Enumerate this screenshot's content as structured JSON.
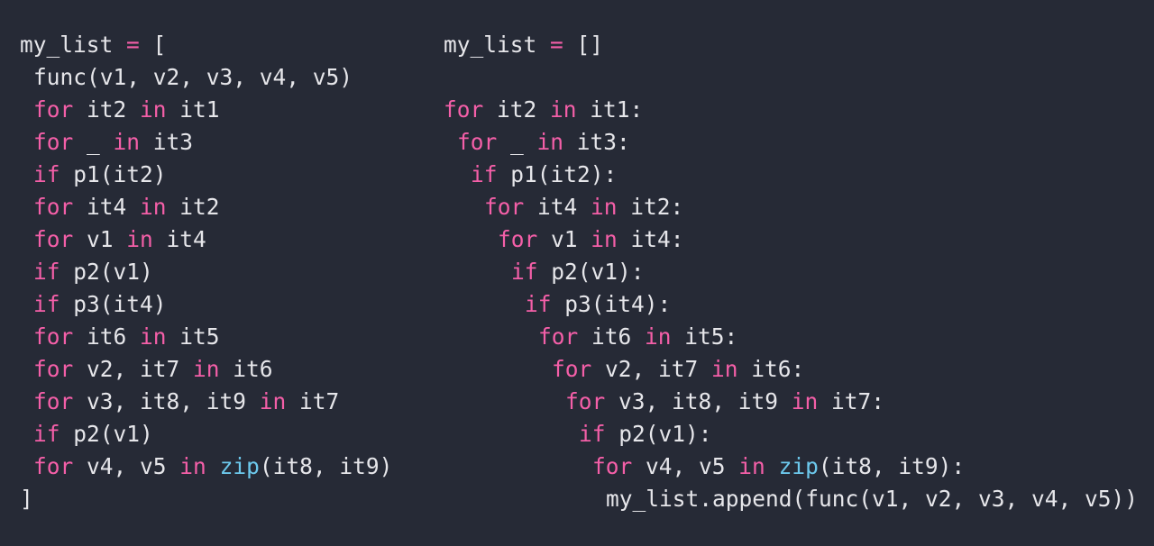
{
  "colors": {
    "background": "#262a36",
    "text": "#e6e6ea",
    "keyword": "#f45fa8",
    "builtin": "#6cc8ec"
  },
  "left_code": {
    "lines": [
      {
        "indent": 0,
        "tokens": [
          {
            "t": "my_list ",
            "k": "tx"
          },
          {
            "t": "=",
            "k": "kw"
          },
          {
            "t": " [",
            "k": "tx"
          }
        ]
      },
      {
        "indent": 1,
        "tokens": [
          {
            "t": "func(v1, v2, v3, v4, v5)",
            "k": "tx"
          }
        ]
      },
      {
        "indent": 1,
        "tokens": [
          {
            "t": "for",
            "k": "kw"
          },
          {
            "t": " it2 ",
            "k": "tx"
          },
          {
            "t": "in",
            "k": "kw"
          },
          {
            "t": " it1",
            "k": "tx"
          }
        ]
      },
      {
        "indent": 1,
        "tokens": [
          {
            "t": "for",
            "k": "kw"
          },
          {
            "t": " _ ",
            "k": "tx"
          },
          {
            "t": "in",
            "k": "kw"
          },
          {
            "t": " it3",
            "k": "tx"
          }
        ]
      },
      {
        "indent": 1,
        "tokens": [
          {
            "t": "if",
            "k": "kw"
          },
          {
            "t": " p1(it2)",
            "k": "tx"
          }
        ]
      },
      {
        "indent": 1,
        "tokens": [
          {
            "t": "for",
            "k": "kw"
          },
          {
            "t": " it4 ",
            "k": "tx"
          },
          {
            "t": "in",
            "k": "kw"
          },
          {
            "t": " it2",
            "k": "tx"
          }
        ]
      },
      {
        "indent": 1,
        "tokens": [
          {
            "t": "for",
            "k": "kw"
          },
          {
            "t": " v1 ",
            "k": "tx"
          },
          {
            "t": "in",
            "k": "kw"
          },
          {
            "t": " it4",
            "k": "tx"
          }
        ]
      },
      {
        "indent": 1,
        "tokens": [
          {
            "t": "if",
            "k": "kw"
          },
          {
            "t": " p2(v1)",
            "k": "tx"
          }
        ]
      },
      {
        "indent": 1,
        "tokens": [
          {
            "t": "if",
            "k": "kw"
          },
          {
            "t": " p3(it4)",
            "k": "tx"
          }
        ]
      },
      {
        "indent": 1,
        "tokens": [
          {
            "t": "for",
            "k": "kw"
          },
          {
            "t": " it6 ",
            "k": "tx"
          },
          {
            "t": "in",
            "k": "kw"
          },
          {
            "t": " it5",
            "k": "tx"
          }
        ]
      },
      {
        "indent": 1,
        "tokens": [
          {
            "t": "for",
            "k": "kw"
          },
          {
            "t": " v2, it7 ",
            "k": "tx"
          },
          {
            "t": "in",
            "k": "kw"
          },
          {
            "t": " it6",
            "k": "tx"
          }
        ]
      },
      {
        "indent": 1,
        "tokens": [
          {
            "t": "for",
            "k": "kw"
          },
          {
            "t": " v3, it8, it9 ",
            "k": "tx"
          },
          {
            "t": "in",
            "k": "kw"
          },
          {
            "t": " it7",
            "k": "tx"
          }
        ]
      },
      {
        "indent": 1,
        "tokens": [
          {
            "t": "if",
            "k": "kw"
          },
          {
            "t": " p2(v1)",
            "k": "tx"
          }
        ]
      },
      {
        "indent": 1,
        "tokens": [
          {
            "t": "for",
            "k": "kw"
          },
          {
            "t": " v4, v5 ",
            "k": "tx"
          },
          {
            "t": "in",
            "k": "kw"
          },
          {
            "t": " ",
            "k": "tx"
          },
          {
            "t": "zip",
            "k": "bi"
          },
          {
            "t": "(it8, it9)",
            "k": "tx"
          }
        ]
      },
      {
        "indent": 0,
        "tokens": [
          {
            "t": "]",
            "k": "tx"
          }
        ]
      }
    ]
  },
  "right_code": {
    "lines": [
      {
        "indent": 0,
        "tokens": [
          {
            "t": "my_list ",
            "k": "tx"
          },
          {
            "t": "=",
            "k": "kw"
          },
          {
            "t": " []",
            "k": "tx"
          }
        ]
      },
      {
        "indent": 0,
        "tokens": []
      },
      {
        "indent": 0,
        "tokens": [
          {
            "t": "for",
            "k": "kw"
          },
          {
            "t": " it2 ",
            "k": "tx"
          },
          {
            "t": "in",
            "k": "kw"
          },
          {
            "t": " it1:",
            "k": "tx"
          }
        ]
      },
      {
        "indent": 1,
        "tokens": [
          {
            "t": "for",
            "k": "kw"
          },
          {
            "t": " _ ",
            "k": "tx"
          },
          {
            "t": "in",
            "k": "kw"
          },
          {
            "t": " it3:",
            "k": "tx"
          }
        ]
      },
      {
        "indent": 2,
        "tokens": [
          {
            "t": "if",
            "k": "kw"
          },
          {
            "t": " p1(it2):",
            "k": "tx"
          }
        ]
      },
      {
        "indent": 3,
        "tokens": [
          {
            "t": "for",
            "k": "kw"
          },
          {
            "t": " it4 ",
            "k": "tx"
          },
          {
            "t": "in",
            "k": "kw"
          },
          {
            "t": " it2:",
            "k": "tx"
          }
        ]
      },
      {
        "indent": 4,
        "tokens": [
          {
            "t": "for",
            "k": "kw"
          },
          {
            "t": " v1 ",
            "k": "tx"
          },
          {
            "t": "in",
            "k": "kw"
          },
          {
            "t": " it4:",
            "k": "tx"
          }
        ]
      },
      {
        "indent": 5,
        "tokens": [
          {
            "t": "if",
            "k": "kw"
          },
          {
            "t": " p2(v1):",
            "k": "tx"
          }
        ]
      },
      {
        "indent": 6,
        "tokens": [
          {
            "t": "if",
            "k": "kw"
          },
          {
            "t": " p3(it4):",
            "k": "tx"
          }
        ]
      },
      {
        "indent": 7,
        "tokens": [
          {
            "t": "for",
            "k": "kw"
          },
          {
            "t": " it6 ",
            "k": "tx"
          },
          {
            "t": "in",
            "k": "kw"
          },
          {
            "t": " it5:",
            "k": "tx"
          }
        ]
      },
      {
        "indent": 8,
        "tokens": [
          {
            "t": "for",
            "k": "kw"
          },
          {
            "t": " v2, it7 ",
            "k": "tx"
          },
          {
            "t": "in",
            "k": "kw"
          },
          {
            "t": " it6:",
            "k": "tx"
          }
        ]
      },
      {
        "indent": 9,
        "tokens": [
          {
            "t": "for",
            "k": "kw"
          },
          {
            "t": " v3, it8, it9 ",
            "k": "tx"
          },
          {
            "t": "in",
            "k": "kw"
          },
          {
            "t": " it7:",
            "k": "tx"
          }
        ]
      },
      {
        "indent": 10,
        "tokens": [
          {
            "t": "if",
            "k": "kw"
          },
          {
            "t": " p2(v1):",
            "k": "tx"
          }
        ]
      },
      {
        "indent": 11,
        "tokens": [
          {
            "t": "for",
            "k": "kw"
          },
          {
            "t": " v4, v5 ",
            "k": "tx"
          },
          {
            "t": "in",
            "k": "kw"
          },
          {
            "t": " ",
            "k": "tx"
          },
          {
            "t": "zip",
            "k": "bi"
          },
          {
            "t": "(it8, it9):",
            "k": "tx"
          }
        ]
      },
      {
        "indent": 12,
        "tokens": [
          {
            "t": "my_list.append(func(v1, v2, v3, v4, v5))",
            "k": "tx"
          }
        ]
      }
    ]
  }
}
